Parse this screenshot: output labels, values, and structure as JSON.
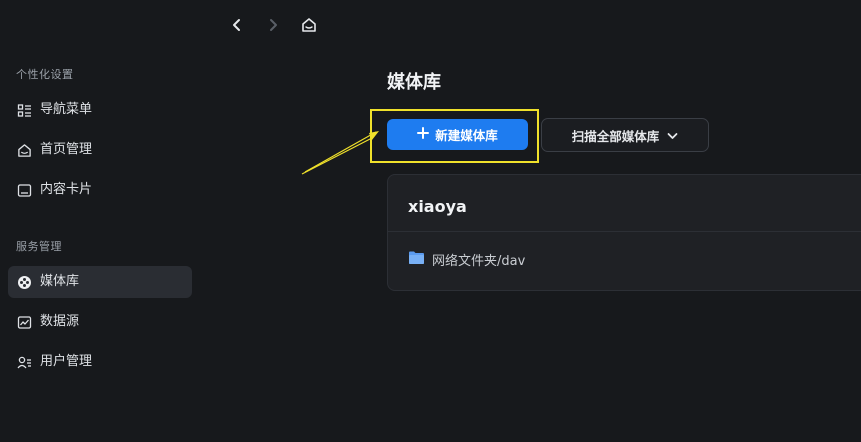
{
  "sidebar": {
    "sections": [
      {
        "title": "个性化设置",
        "items": [
          {
            "label": "导航菜单",
            "icon": "menu-list-icon"
          },
          {
            "label": "首页管理",
            "icon": "home-icon"
          },
          {
            "label": "内容卡片",
            "icon": "card-icon"
          }
        ]
      },
      {
        "title": "服务管理",
        "items": [
          {
            "label": "媒体库",
            "icon": "film-reel-icon",
            "active": true
          },
          {
            "label": "数据源",
            "icon": "chart-icon"
          },
          {
            "label": "用户管理",
            "icon": "users-icon"
          }
        ]
      }
    ]
  },
  "topnav": {
    "icons": [
      "chevron-left-icon",
      "chevron-right-icon",
      "home-icon"
    ]
  },
  "main": {
    "title": "媒体库",
    "new_button_label": "新建媒体库",
    "scan_button_label": "扫描全部媒体库",
    "library": {
      "name": "xiaoya",
      "path": "网络文件夹/dav"
    }
  },
  "colors": {
    "accent": "#1e7cf0",
    "highlight": "#f0e12b",
    "background": "#17191c",
    "card": "#1f2125"
  }
}
